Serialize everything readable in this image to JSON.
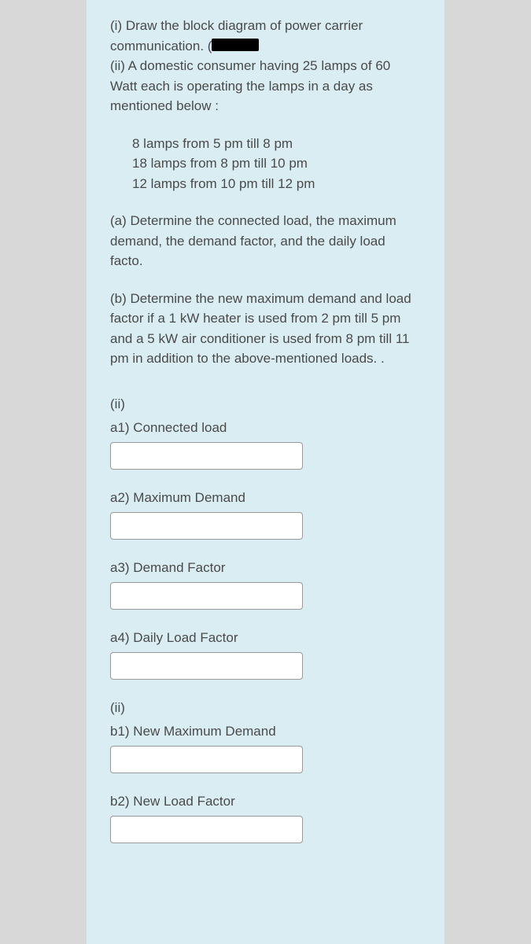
{
  "question": {
    "part_i": "(i) Draw the block diagram of power carrier communication. (",
    "part_ii_intro": "(ii) A domestic consumer having 25 lamps of 60 Watt each is operating the lamps in a day as mentioned below :",
    "schedule": [
      "8 lamps from 5 pm till 8 pm",
      "18 lamps from 8 pm till 10 pm",
      "12 lamps from 10 pm till 12 pm"
    ],
    "part_a": "(a) Determine the connected load, the maximum demand, the demand factor, and the daily load facto.",
    "part_b": "(b) Determine the new maximum demand and load factor if a 1 kW heater is used from 2 pm till 5 pm and a 5 kW air conditioner is used from 8 pm till 11 pm in addition to the above-mentioned loads. ."
  },
  "answers": {
    "section_ii": "(ii)",
    "a1_label": "a1) Connected load",
    "a1_value": "",
    "a2_label": "a2) Maximum Demand",
    "a2_value": "",
    "a3_label": "a3) Demand Factor",
    "a3_value": "",
    "a4_label": "a4) Daily Load Factor",
    "a4_value": "",
    "b1_label": "b1) New Maximum Demand",
    "b1_value": "",
    "b2_label": "b2) New Load Factor",
    "b2_value": ""
  }
}
